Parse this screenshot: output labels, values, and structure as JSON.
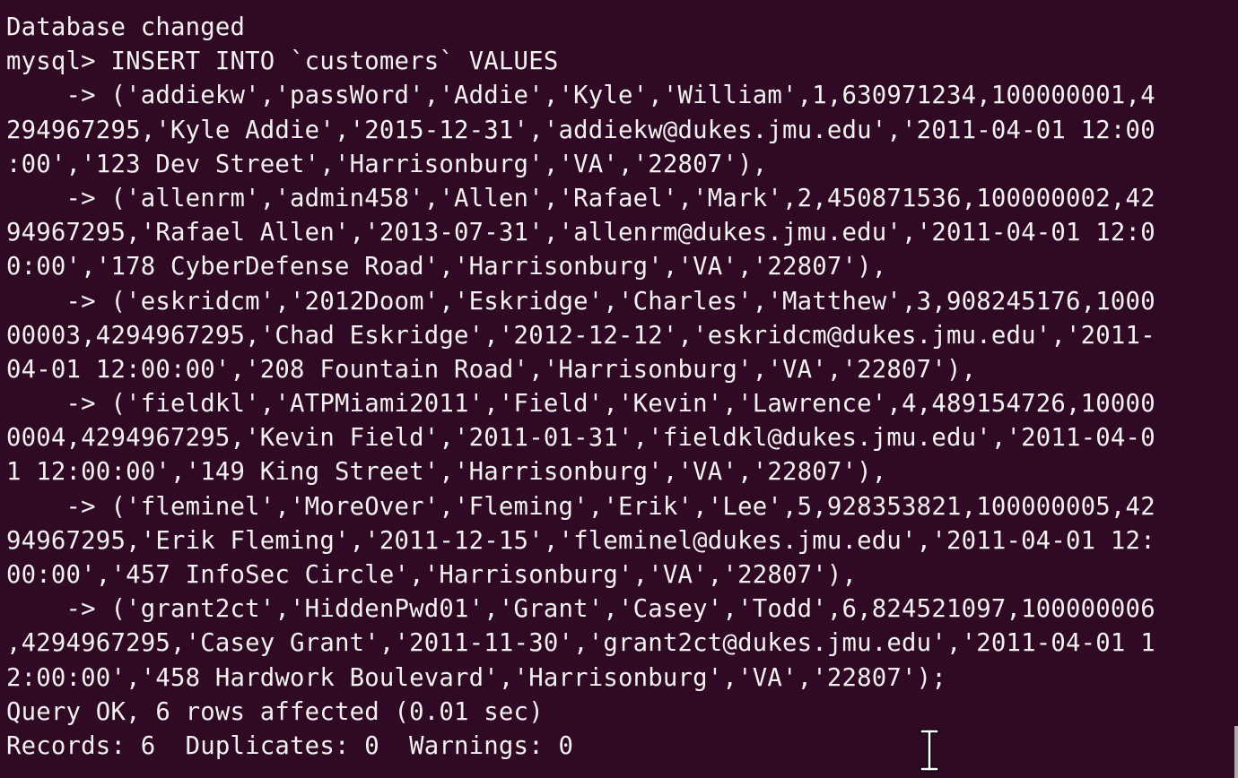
{
  "terminal": {
    "lines": [
      "Database changed",
      "mysql> INSERT INTO `customers` VALUES",
      "    -> ('addiekw','passWord','Addie','Kyle','William',1,630971234,100000001,4",
      "294967295,'Kyle Addie','2015-12-31','addiekw@dukes.jmu.edu','2011-04-01 12:00",
      ":00','123 Dev Street','Harrisonburg','VA','22807'),",
      "    -> ('allenrm','admin458','Allen','Rafael','Mark',2,450871536,100000002,42",
      "94967295,'Rafael Allen','2013-07-31','allenrm@dukes.jmu.edu','2011-04-01 12:0",
      "0:00','178 CyberDefense Road','Harrisonburg','VA','22807'),",
      "    -> ('eskridcm','2012Doom','Eskridge','Charles','Matthew',3,908245176,1000",
      "00003,4294967295,'Chad Eskridge','2012-12-12','eskridcm@dukes.jmu.edu','2011-",
      "04-01 12:00:00','208 Fountain Road','Harrisonburg','VA','22807'),",
      "    -> ('fieldkl','ATPMiami2011','Field','Kevin','Lawrence',4,489154726,10000",
      "0004,4294967295,'Kevin Field','2011-01-31','fieldkl@dukes.jmu.edu','2011-04-0",
      "1 12:00:00','149 King Street','Harrisonburg','VA','22807'),",
      "    -> ('fleminel','MoreOver','Fleming','Erik','Lee',5,928353821,100000005,42",
      "94967295,'Erik Fleming','2011-12-15','fleminel@dukes.jmu.edu','2011-04-01 12:",
      "00:00','457 InfoSec Circle','Harrisonburg','VA','22807'),",
      "    -> ('grant2ct','HiddenPwd01','Grant','Casey','Todd',6,824521097,100000006",
      ",4294967295,'Casey Grant','2011-11-30','grant2ct@dukes.jmu.edu','2011-04-01 1",
      "2:00:00','458 Hardwork Boulevard','Harrisonburg','VA','22807');",
      "Query OK, 6 rows affected (0.01 sec)",
      "Records: 6  Duplicates: 0  Warnings: 0"
    ]
  },
  "cursor_icon": "text-ibeam-cursor-icon",
  "colors": {
    "background": "#300a24",
    "foreground": "#f1f1ef"
  }
}
